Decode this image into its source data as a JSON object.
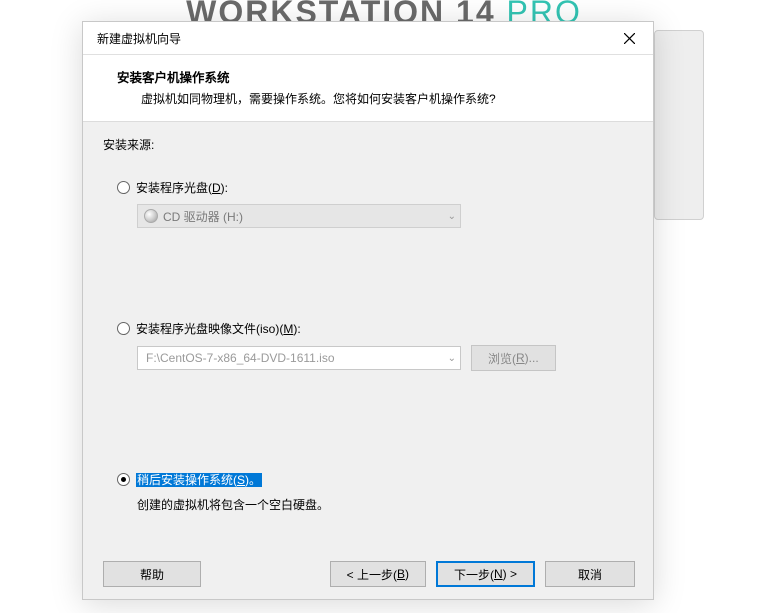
{
  "bg_logo": {
    "left": "WORKSTATION 14",
    "right": " PRO"
  },
  "dialog": {
    "title": "新建虚拟机向导",
    "header_title": "安装客户机操作系统",
    "header_sub": "虚拟机如同物理机，需要操作系统。您将如何安装客户机操作系统?",
    "src_label": "安装来源:",
    "opt1": {
      "label_pre": "安装程序光盘(",
      "akey": "D",
      "label_post": "):",
      "dropdown_text": "CD 驱动器 (H:)"
    },
    "opt2": {
      "label_pre": "安装程序光盘映像文件(iso)(",
      "akey": "M",
      "label_post": "):",
      "combo_text": "F:\\CentOS-7-x86_64-DVD-1611.iso",
      "browse_pre": "浏览(",
      "browse_akey": "R",
      "browse_post": ")..."
    },
    "opt3": {
      "label_pre": "稍后安装操作系统(",
      "akey": "S",
      "label_post": ")。",
      "hint": "创建的虚拟机将包含一个空白硬盘。"
    },
    "buttons": {
      "help": "帮助",
      "back_pre": "< 上一步(",
      "back_akey": "B",
      "back_post": ")",
      "next_pre": "下一步(",
      "next_akey": "N",
      "next_post": ") >",
      "cancel": "取消"
    }
  }
}
